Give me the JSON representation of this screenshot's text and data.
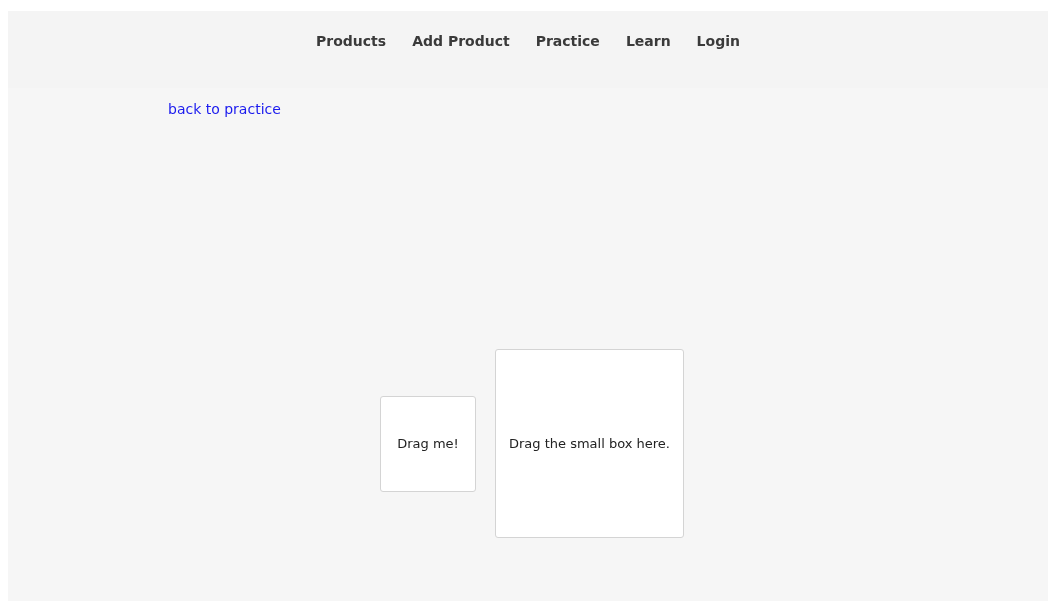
{
  "nav": {
    "items": [
      {
        "label": "Products"
      },
      {
        "label": "Add Product"
      },
      {
        "label": "Practice"
      },
      {
        "label": "Learn"
      },
      {
        "label": "Login"
      }
    ]
  },
  "back_link": "back to practice",
  "drag_item": {
    "label": "Drag me!"
  },
  "drop_zone": {
    "label": "Drag the small box here."
  }
}
